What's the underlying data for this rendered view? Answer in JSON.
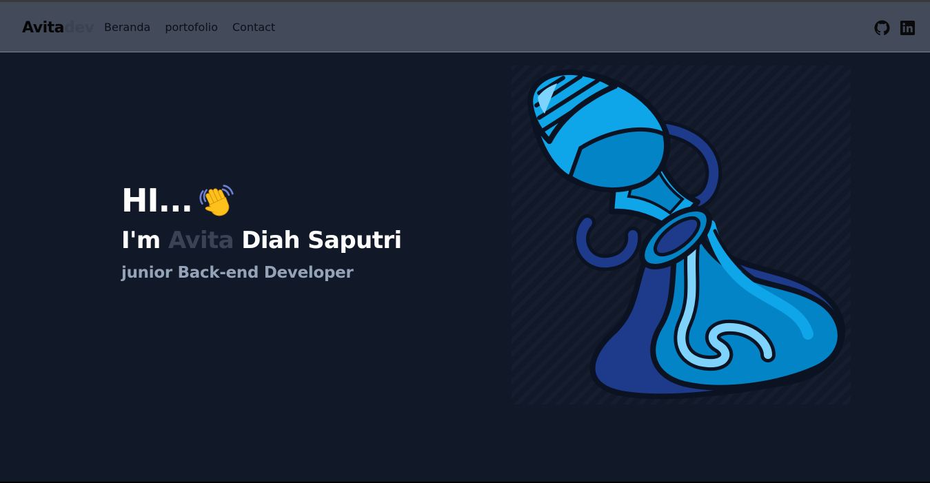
{
  "navbar": {
    "brand_main": "Avita",
    "brand_suffix": "dev",
    "links": [
      "Beranda",
      "portofolio",
      "Contact"
    ],
    "icons": [
      "github-icon",
      "linkedin-icon"
    ]
  },
  "hero": {
    "greeting": "HI...",
    "greeting_emoji": "waving-hand-icon",
    "intro_prefix": "I'm ",
    "intro_highlight": "Avita",
    "intro_suffix": " Diah Saputri",
    "role": "junior Back-end Developer",
    "illustration": "aquarius-water-jar-illustration"
  },
  "colors": {
    "page_bg": "#111827",
    "navbar_bg": "#434b5b",
    "highlight_text": "#3a4354",
    "role_text": "#94a3b8",
    "accent_light_blue": "#0ea5e9",
    "accent_dark_blue": "#1e3a8a"
  }
}
